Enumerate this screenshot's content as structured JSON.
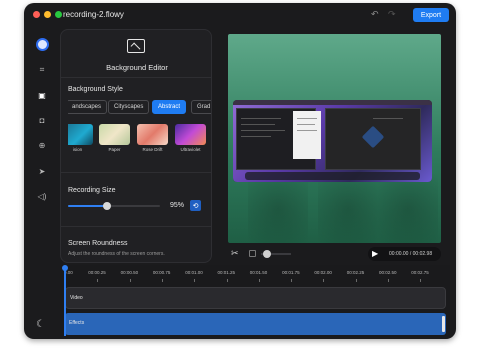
{
  "window": {
    "title": "recording-2.flowy"
  },
  "toolbar": {
    "undo_icon": "undo-icon",
    "redo_icon": "redo-icon",
    "export_label": "Export"
  },
  "rail": {
    "icons": [
      "app-logo-icon",
      "crop-icon",
      "image-icon",
      "camera-icon",
      "zoom-icon",
      "cursor-icon",
      "audio-icon",
      "moon-icon"
    ],
    "active": "image-icon"
  },
  "panel": {
    "title": "Background Editor",
    "background_style_label": "Background Style",
    "chips": [
      "andscapes",
      "Cityscapes",
      "Abstract",
      "Grad"
    ],
    "active_chip": "Abstract",
    "thumbnails": [
      {
        "label": "ision"
      },
      {
        "label": "Paper"
      },
      {
        "label": "Rose Drift"
      },
      {
        "label": "Ultraviolet"
      }
    ],
    "recording_size_label": "Recording Size",
    "recording_size_value": 95,
    "recording_size_text": "95%",
    "roundness_label": "Screen Roundness",
    "roundness_sub": "Adjust the roundness of the screen corners."
  },
  "playback": {
    "time_text": "00:00.00 / 00:02.98",
    "play_icon": "play-icon",
    "cut_icon": "scissors-icon",
    "zoom_level": 0.1
  },
  "timeline": {
    "ticks": [
      "0.00",
      "00:00.25",
      "00:00.50",
      "00:00.75",
      "00:01.00",
      "00:01.25",
      "00:01.50",
      "00:01.75",
      "00:02.00",
      "00:02.25",
      "00:02.50",
      "00:02.75"
    ],
    "tracks": {
      "video": "Video",
      "effects": "Effects"
    }
  },
  "colors": {
    "accent": "#1f7cf2",
    "effects_track": "#2a66b8",
    "preview_bg": "#3b8a6a"
  }
}
